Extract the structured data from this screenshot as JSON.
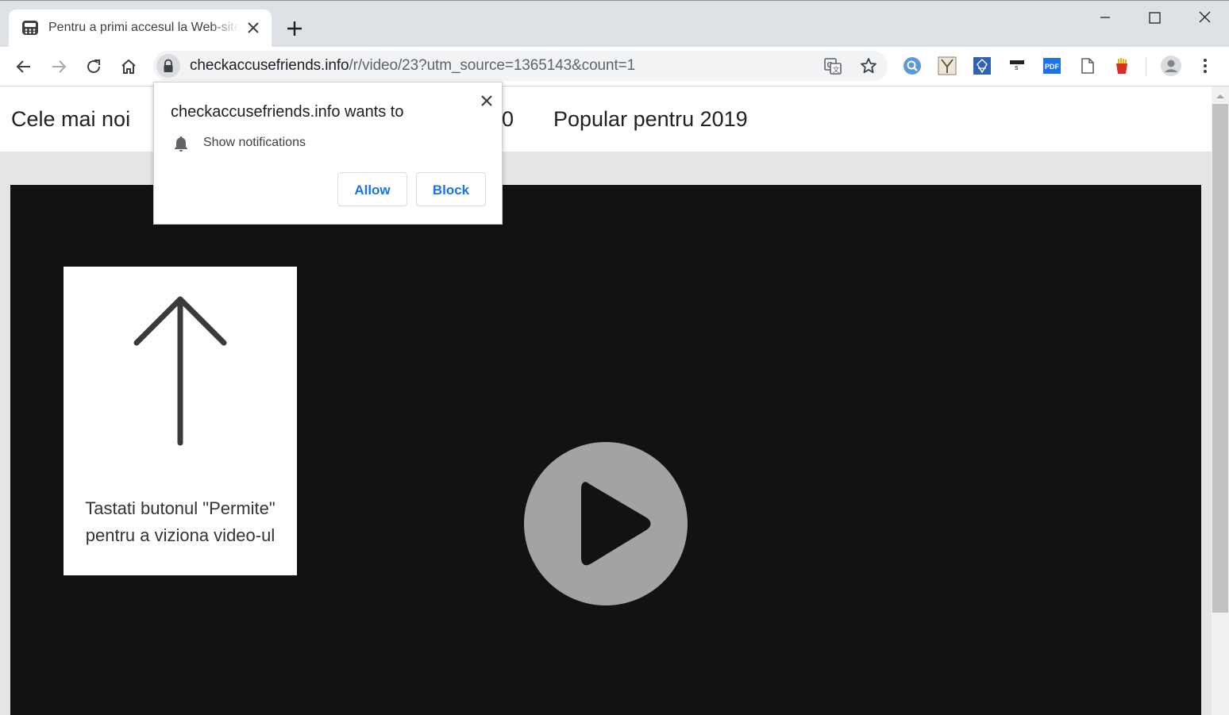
{
  "browser": {
    "tab": {
      "title": "Pentru a primi accesul la Web-site",
      "favicon": "keyboard-favicon-icon",
      "close_icon": "close-icon"
    },
    "new_tab_icon": "plus-icon",
    "window_controls": [
      "minimize-icon",
      "maximize-icon",
      "close-icon"
    ],
    "toolbar": {
      "nav_icons": [
        "back-arrow-icon",
        "forward-arrow-icon",
        "reload-icon",
        "home-icon"
      ],
      "url_host": "checkaccusefriends.info",
      "url_path": "/r/video/23?utm_source=1365143&count=1",
      "omnibox_icons": [
        "translate-icon",
        "bookmark-star-icon"
      ],
      "extensions": [
        "search-extension-icon",
        "yoroi-extension-icon",
        "adguard-extension-icon",
        "s-extension-icon",
        "pdf-extension-icon",
        "page-extension-icon",
        "fries-extension-icon"
      ],
      "profile_icon": "avatar-icon",
      "menu_icon": "kebab-menu-icon"
    }
  },
  "site": {
    "nav": {
      "left": "Cele mai noi",
      "partial": "0",
      "right": "Popular pentru 2019"
    },
    "hint": {
      "arrow_icon": "up-arrow-icon",
      "text": "Tastati butonul \"Permite\"\npentru a viziona video-ul"
    },
    "player": {
      "play_icon": "play-icon"
    }
  },
  "permission_prompt": {
    "title": "checkaccusefriends.info wants to",
    "bell_icon": "bell-icon",
    "permission": "Show notifications",
    "allow_label": "Allow",
    "block_label": "Block"
  },
  "colors": {
    "accent_blue": "#1a73e8",
    "video_bg": "#121212",
    "page_bg": "#e5e5e5",
    "tabstrip_bg": "#dee1e6"
  }
}
